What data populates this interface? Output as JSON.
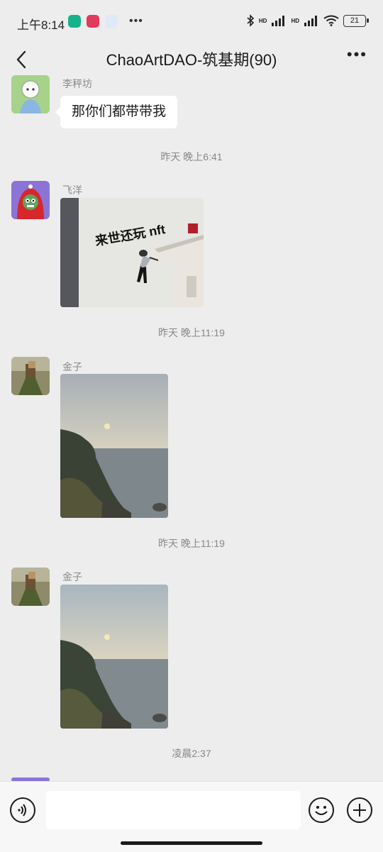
{
  "status_bar": {
    "time": "上午8:14",
    "battery": "21",
    "network": "HD"
  },
  "header": {
    "title": "ChaoArtDAO-筑基期(90)",
    "back_icon": "chevron-left-icon",
    "more_icon": "more-dots-icon"
  },
  "messages": [
    {
      "sender": "李秤坊",
      "text": "那你们都带带我"
    },
    {
      "time": "昨天 晚上6:41"
    },
    {
      "sender": "飞洋",
      "image_caption": "来世还玩 nft"
    },
    {
      "time": "昨天 晚上11:19"
    },
    {
      "sender": "金子"
    },
    {
      "time": "昨天 晚上11:19"
    },
    {
      "sender": "金子"
    },
    {
      "time": "凌晨2:37"
    }
  ],
  "input": {
    "placeholder": "",
    "voice_icon": "voice-icon",
    "emoji_icon": "emoji-icon",
    "plus_icon": "plus-icon"
  }
}
